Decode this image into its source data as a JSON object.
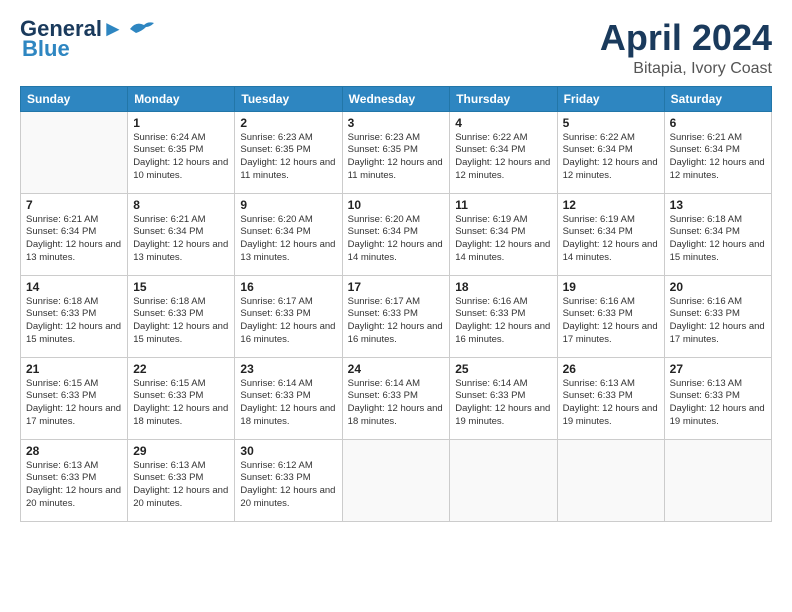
{
  "header": {
    "logo_line1": "General",
    "logo_line2": "Blue",
    "main_title": "April 2024",
    "subtitle": "Bitapia, Ivory Coast"
  },
  "days_of_week": [
    "Sunday",
    "Monday",
    "Tuesday",
    "Wednesday",
    "Thursday",
    "Friday",
    "Saturday"
  ],
  "weeks": [
    [
      {
        "num": "",
        "sunrise": "",
        "sunset": "",
        "daylight": ""
      },
      {
        "num": "1",
        "sunrise": "Sunrise: 6:24 AM",
        "sunset": "Sunset: 6:35 PM",
        "daylight": "Daylight: 12 hours and 10 minutes."
      },
      {
        "num": "2",
        "sunrise": "Sunrise: 6:23 AM",
        "sunset": "Sunset: 6:35 PM",
        "daylight": "Daylight: 12 hours and 11 minutes."
      },
      {
        "num": "3",
        "sunrise": "Sunrise: 6:23 AM",
        "sunset": "Sunset: 6:35 PM",
        "daylight": "Daylight: 12 hours and 11 minutes."
      },
      {
        "num": "4",
        "sunrise": "Sunrise: 6:22 AM",
        "sunset": "Sunset: 6:34 PM",
        "daylight": "Daylight: 12 hours and 12 minutes."
      },
      {
        "num": "5",
        "sunrise": "Sunrise: 6:22 AM",
        "sunset": "Sunset: 6:34 PM",
        "daylight": "Daylight: 12 hours and 12 minutes."
      },
      {
        "num": "6",
        "sunrise": "Sunrise: 6:21 AM",
        "sunset": "Sunset: 6:34 PM",
        "daylight": "Daylight: 12 hours and 12 minutes."
      }
    ],
    [
      {
        "num": "7",
        "sunrise": "Sunrise: 6:21 AM",
        "sunset": "Sunset: 6:34 PM",
        "daylight": "Daylight: 12 hours and 13 minutes."
      },
      {
        "num": "8",
        "sunrise": "Sunrise: 6:21 AM",
        "sunset": "Sunset: 6:34 PM",
        "daylight": "Daylight: 12 hours and 13 minutes."
      },
      {
        "num": "9",
        "sunrise": "Sunrise: 6:20 AM",
        "sunset": "Sunset: 6:34 PM",
        "daylight": "Daylight: 12 hours and 13 minutes."
      },
      {
        "num": "10",
        "sunrise": "Sunrise: 6:20 AM",
        "sunset": "Sunset: 6:34 PM",
        "daylight": "Daylight: 12 hours and 14 minutes."
      },
      {
        "num": "11",
        "sunrise": "Sunrise: 6:19 AM",
        "sunset": "Sunset: 6:34 PM",
        "daylight": "Daylight: 12 hours and 14 minutes."
      },
      {
        "num": "12",
        "sunrise": "Sunrise: 6:19 AM",
        "sunset": "Sunset: 6:34 PM",
        "daylight": "Daylight: 12 hours and 14 minutes."
      },
      {
        "num": "13",
        "sunrise": "Sunrise: 6:18 AM",
        "sunset": "Sunset: 6:34 PM",
        "daylight": "Daylight: 12 hours and 15 minutes."
      }
    ],
    [
      {
        "num": "14",
        "sunrise": "Sunrise: 6:18 AM",
        "sunset": "Sunset: 6:33 PM",
        "daylight": "Daylight: 12 hours and 15 minutes."
      },
      {
        "num": "15",
        "sunrise": "Sunrise: 6:18 AM",
        "sunset": "Sunset: 6:33 PM",
        "daylight": "Daylight: 12 hours and 15 minutes."
      },
      {
        "num": "16",
        "sunrise": "Sunrise: 6:17 AM",
        "sunset": "Sunset: 6:33 PM",
        "daylight": "Daylight: 12 hours and 16 minutes."
      },
      {
        "num": "17",
        "sunrise": "Sunrise: 6:17 AM",
        "sunset": "Sunset: 6:33 PM",
        "daylight": "Daylight: 12 hours and 16 minutes."
      },
      {
        "num": "18",
        "sunrise": "Sunrise: 6:16 AM",
        "sunset": "Sunset: 6:33 PM",
        "daylight": "Daylight: 12 hours and 16 minutes."
      },
      {
        "num": "19",
        "sunrise": "Sunrise: 6:16 AM",
        "sunset": "Sunset: 6:33 PM",
        "daylight": "Daylight: 12 hours and 17 minutes."
      },
      {
        "num": "20",
        "sunrise": "Sunrise: 6:16 AM",
        "sunset": "Sunset: 6:33 PM",
        "daylight": "Daylight: 12 hours and 17 minutes."
      }
    ],
    [
      {
        "num": "21",
        "sunrise": "Sunrise: 6:15 AM",
        "sunset": "Sunset: 6:33 PM",
        "daylight": "Daylight: 12 hours and 17 minutes."
      },
      {
        "num": "22",
        "sunrise": "Sunrise: 6:15 AM",
        "sunset": "Sunset: 6:33 PM",
        "daylight": "Daylight: 12 hours and 18 minutes."
      },
      {
        "num": "23",
        "sunrise": "Sunrise: 6:14 AM",
        "sunset": "Sunset: 6:33 PM",
        "daylight": "Daylight: 12 hours and 18 minutes."
      },
      {
        "num": "24",
        "sunrise": "Sunrise: 6:14 AM",
        "sunset": "Sunset: 6:33 PM",
        "daylight": "Daylight: 12 hours and 18 minutes."
      },
      {
        "num": "25",
        "sunrise": "Sunrise: 6:14 AM",
        "sunset": "Sunset: 6:33 PM",
        "daylight": "Daylight: 12 hours and 19 minutes."
      },
      {
        "num": "26",
        "sunrise": "Sunrise: 6:13 AM",
        "sunset": "Sunset: 6:33 PM",
        "daylight": "Daylight: 12 hours and 19 minutes."
      },
      {
        "num": "27",
        "sunrise": "Sunrise: 6:13 AM",
        "sunset": "Sunset: 6:33 PM",
        "daylight": "Daylight: 12 hours and 19 minutes."
      }
    ],
    [
      {
        "num": "28",
        "sunrise": "Sunrise: 6:13 AM",
        "sunset": "Sunset: 6:33 PM",
        "daylight": "Daylight: 12 hours and 20 minutes."
      },
      {
        "num": "29",
        "sunrise": "Sunrise: 6:13 AM",
        "sunset": "Sunset: 6:33 PM",
        "daylight": "Daylight: 12 hours and 20 minutes."
      },
      {
        "num": "30",
        "sunrise": "Sunrise: 6:12 AM",
        "sunset": "Sunset: 6:33 PM",
        "daylight": "Daylight: 12 hours and 20 minutes."
      },
      {
        "num": "",
        "sunrise": "",
        "sunset": "",
        "daylight": ""
      },
      {
        "num": "",
        "sunrise": "",
        "sunset": "",
        "daylight": ""
      },
      {
        "num": "",
        "sunrise": "",
        "sunset": "",
        "daylight": ""
      },
      {
        "num": "",
        "sunrise": "",
        "sunset": "",
        "daylight": ""
      }
    ]
  ]
}
